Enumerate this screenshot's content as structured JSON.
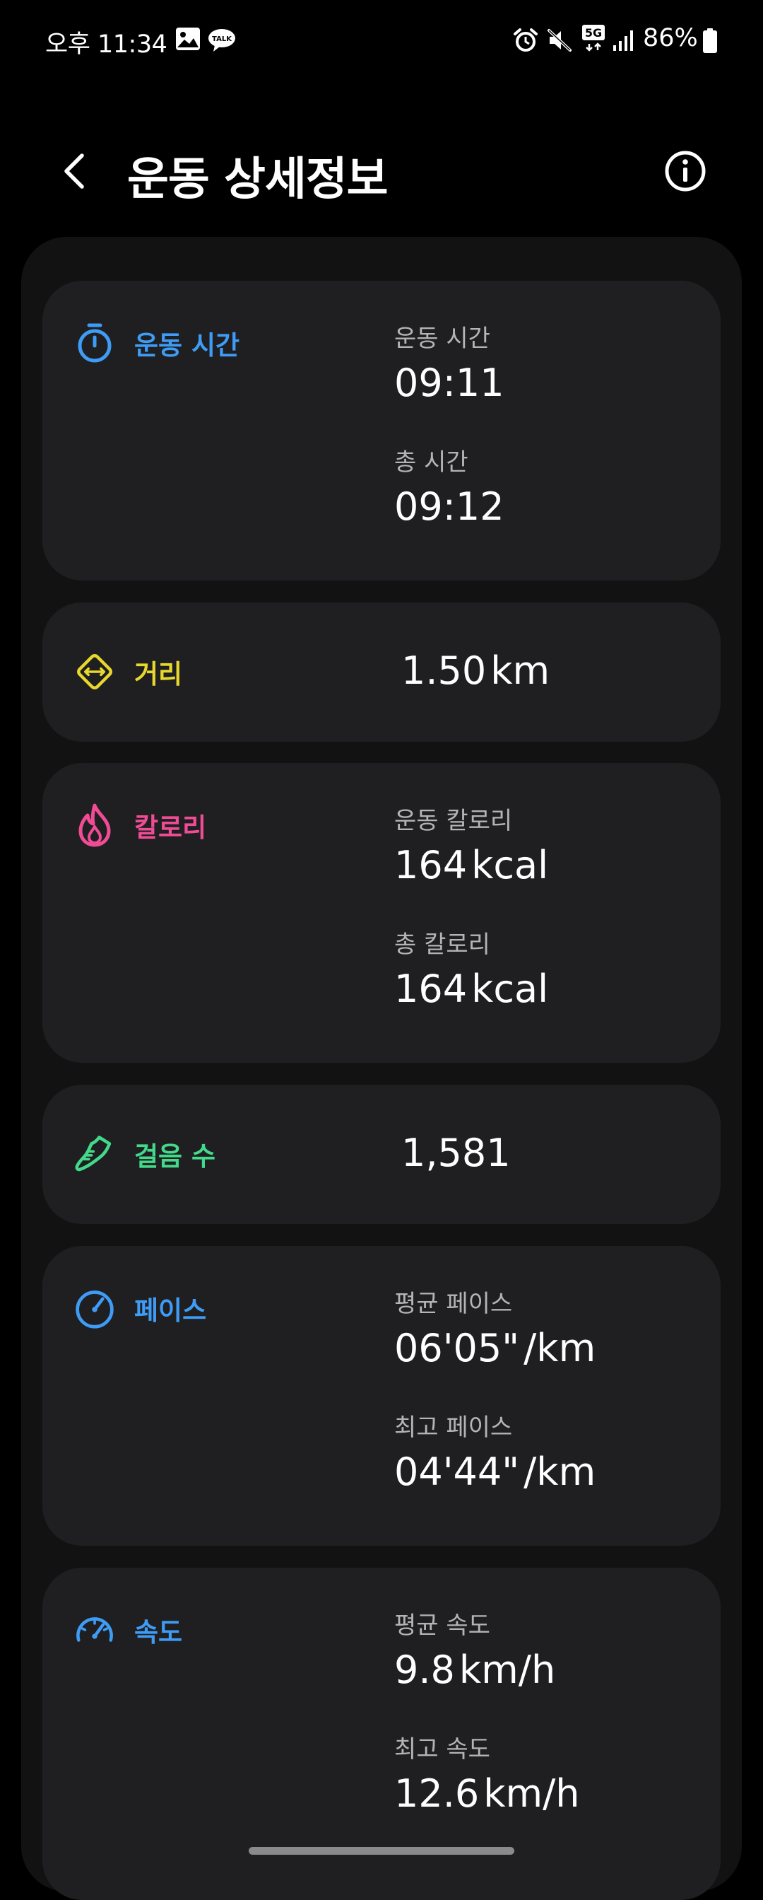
{
  "status_bar": {
    "time": "오후 11:34",
    "battery": "86%",
    "network_label": "5G",
    "icons": [
      "image-icon",
      "talk-icon",
      "alarm-icon",
      "mute-icon",
      "5g-icon",
      "signal-icon",
      "battery-icon"
    ],
    "talk_label": "TALK"
  },
  "header": {
    "title": "운동 상세정보",
    "back_icon": "back-arrow-icon",
    "info_icon": "info-icon"
  },
  "cards": {
    "workout_time": {
      "label": "운동 시간",
      "icon": "stopwatch-icon",
      "color": "#3f9cf5",
      "metrics": [
        {
          "label": "운동 시간",
          "value": "09:11"
        },
        {
          "label": "총 시간",
          "value": "09:12"
        }
      ]
    },
    "distance": {
      "label": "거리",
      "icon": "distance-icon",
      "color": "#e8d82e",
      "value": "1.50",
      "unit": "km"
    },
    "calories": {
      "label": "칼로리",
      "icon": "flame-icon",
      "color": "#f04c96",
      "metrics": [
        {
          "label": "운동 칼로리",
          "value": "164",
          "unit": "kcal"
        },
        {
          "label": "총 칼로리",
          "value": "164",
          "unit": "kcal"
        }
      ]
    },
    "steps": {
      "label": "걸음 수",
      "icon": "shoe-icon",
      "color": "#43d98a",
      "value": "1,581"
    },
    "pace": {
      "label": "페이스",
      "icon": "pace-gauge-icon",
      "color": "#3f9cf5",
      "metrics": [
        {
          "label": "평균 페이스",
          "value": "06'05\"",
          "unit": "/km"
        },
        {
          "label": "최고 페이스",
          "value": "04'44\"",
          "unit": "/km"
        }
      ]
    },
    "speed": {
      "label": "속도",
      "icon": "speedometer-icon",
      "color": "#3f9cf5",
      "metrics": [
        {
          "label": "평균 속도",
          "value": "9.8",
          "unit": "km/h"
        },
        {
          "label": "최고 속도",
          "value": "12.6",
          "unit": "km/h"
        }
      ]
    }
  }
}
